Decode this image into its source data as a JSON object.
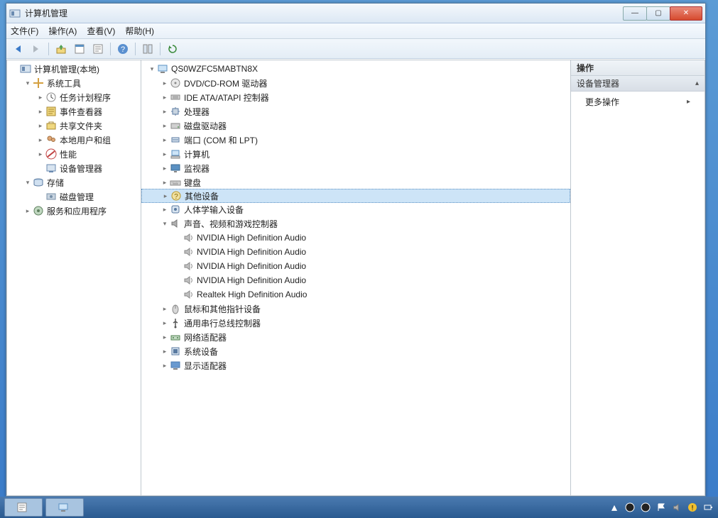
{
  "window": {
    "title": "计算机管理"
  },
  "menu": {
    "file": "文件(F)",
    "action": "操作(A)",
    "view": "查看(V)",
    "help": "帮助(H)"
  },
  "winbtn": {
    "min": "—",
    "max": "▢",
    "close": "✕"
  },
  "leftTree": [
    {
      "indent": 0,
      "exp": "",
      "icon": "console",
      "label": "计算机管理(本地)"
    },
    {
      "indent": 1,
      "exp": "▾",
      "icon": "tools",
      "label": "系统工具"
    },
    {
      "indent": 2,
      "exp": "▸",
      "icon": "scheduler",
      "label": "任务计划程序"
    },
    {
      "indent": 2,
      "exp": "▸",
      "icon": "event",
      "label": "事件查看器"
    },
    {
      "indent": 2,
      "exp": "▸",
      "icon": "share",
      "label": "共享文件夹"
    },
    {
      "indent": 2,
      "exp": "▸",
      "icon": "users",
      "label": "本地用户和组"
    },
    {
      "indent": 2,
      "exp": "▸",
      "icon": "perf",
      "label": "性能"
    },
    {
      "indent": 2,
      "exp": "",
      "icon": "device",
      "label": "设备管理器",
      "selected": false
    },
    {
      "indent": 1,
      "exp": "▾",
      "icon": "storage",
      "label": "存储"
    },
    {
      "indent": 2,
      "exp": "",
      "icon": "disk",
      "label": "磁盘管理"
    },
    {
      "indent": 1,
      "exp": "▸",
      "icon": "services",
      "label": "服务和应用程序"
    }
  ],
  "centerTree": [
    {
      "indent": 0,
      "exp": "▾",
      "icon": "computer",
      "label": "QS0WZFC5MABTN8X"
    },
    {
      "indent": 1,
      "exp": "▸",
      "icon": "dvd",
      "label": "DVD/CD-ROM 驱动器"
    },
    {
      "indent": 1,
      "exp": "▸",
      "icon": "ide",
      "label": "IDE ATA/ATAPI 控制器"
    },
    {
      "indent": 1,
      "exp": "▸",
      "icon": "cpu",
      "label": "处理器"
    },
    {
      "indent": 1,
      "exp": "▸",
      "icon": "diskdrive",
      "label": "磁盘驱动器"
    },
    {
      "indent": 1,
      "exp": "▸",
      "icon": "port",
      "label": "端口 (COM 和 LPT)"
    },
    {
      "indent": 1,
      "exp": "▸",
      "icon": "pc",
      "label": "计算机"
    },
    {
      "indent": 1,
      "exp": "▸",
      "icon": "monitor",
      "label": "监视器"
    },
    {
      "indent": 1,
      "exp": "▸",
      "icon": "keyboard",
      "label": "键盘"
    },
    {
      "indent": 1,
      "exp": "▸",
      "icon": "other",
      "label": "其他设备",
      "selected": true
    },
    {
      "indent": 1,
      "exp": "▸",
      "icon": "hid",
      "label": "人体学输入设备"
    },
    {
      "indent": 1,
      "exp": "▾",
      "icon": "sound",
      "label": "声音、视频和游戏控制器"
    },
    {
      "indent": 2,
      "exp": "",
      "icon": "speaker",
      "label": "NVIDIA High Definition Audio"
    },
    {
      "indent": 2,
      "exp": "",
      "icon": "speaker",
      "label": "NVIDIA High Definition Audio"
    },
    {
      "indent": 2,
      "exp": "",
      "icon": "speaker",
      "label": "NVIDIA High Definition Audio"
    },
    {
      "indent": 2,
      "exp": "",
      "icon": "speaker",
      "label": "NVIDIA High Definition Audio"
    },
    {
      "indent": 2,
      "exp": "",
      "icon": "speaker",
      "label": "Realtek High Definition Audio"
    },
    {
      "indent": 1,
      "exp": "▸",
      "icon": "mouse",
      "label": "鼠标和其他指针设备"
    },
    {
      "indent": 1,
      "exp": "▸",
      "icon": "usb",
      "label": "通用串行总线控制器"
    },
    {
      "indent": 1,
      "exp": "▸",
      "icon": "network",
      "label": "网络适配器"
    },
    {
      "indent": 1,
      "exp": "▸",
      "icon": "system",
      "label": "系统设备"
    },
    {
      "indent": 1,
      "exp": "▸",
      "icon": "display",
      "label": "显示适配器"
    }
  ],
  "actions": {
    "header": "操作",
    "sub": "设备管理器",
    "item1": "更多操作"
  }
}
